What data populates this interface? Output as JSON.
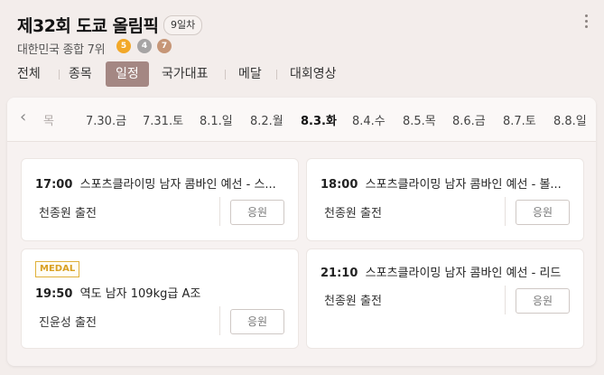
{
  "header": {
    "title": "제32회 도쿄 올림픽",
    "day_badge": "9일차",
    "rank_text": "대한민국 종합 7위",
    "medals": {
      "gold": "5",
      "silver": "4",
      "bronze": "7"
    },
    "more_icon": "more-vertical-icon"
  },
  "tabs": [
    {
      "label": "전체",
      "active": false
    },
    {
      "label": "종목",
      "active": false
    },
    {
      "label": "일정",
      "active": true
    },
    {
      "label": "국가대표",
      "active": false
    },
    {
      "label": "메달",
      "active": false
    },
    {
      "label": "대회영상",
      "active": false
    }
  ],
  "dates": {
    "prev_icon": "chevron-left-icon",
    "items": [
      {
        "label": "목",
        "selected": false
      },
      {
        "label": "7.30.금",
        "selected": false
      },
      {
        "label": "7.31.토",
        "selected": false
      },
      {
        "label": "8.1.일",
        "selected": false
      },
      {
        "label": "8.2.월",
        "selected": false
      },
      {
        "label": "8.3.화",
        "selected": true
      },
      {
        "label": "8.4.수",
        "selected": false
      },
      {
        "label": "8.5.목",
        "selected": false
      },
      {
        "label": "8.6.금",
        "selected": false
      },
      {
        "label": "8.7.토",
        "selected": false
      },
      {
        "label": "8.8.일",
        "selected": false
      }
    ]
  },
  "events": [
    {
      "time": "17:00",
      "title": "스포츠클라이밍 남자 콤바인 예선 - 스...",
      "athlete": "천종원 출전",
      "cheer": "응원",
      "medal": ""
    },
    {
      "time": "18:00",
      "title": "스포츠클라이밍 남자 콤바인 예선 - 볼...",
      "athlete": "천종원 출전",
      "cheer": "응원",
      "medal": ""
    },
    {
      "time": "19:50",
      "title": "역도 남자 109kg급 A조",
      "athlete": "진윤성 출전",
      "cheer": "응원",
      "medal": "MEDAL"
    },
    {
      "time": "21:10",
      "title": "스포츠클라이밍 남자 콤바인 예선 - 리드",
      "athlete": "천종원 출전",
      "cheer": "응원",
      "medal": ""
    }
  ],
  "colors": {
    "accent": "#a48783",
    "medal_gold": "#f2a829",
    "medal_silver": "#a6a4a4",
    "medal_bronze": "#c69677"
  }
}
